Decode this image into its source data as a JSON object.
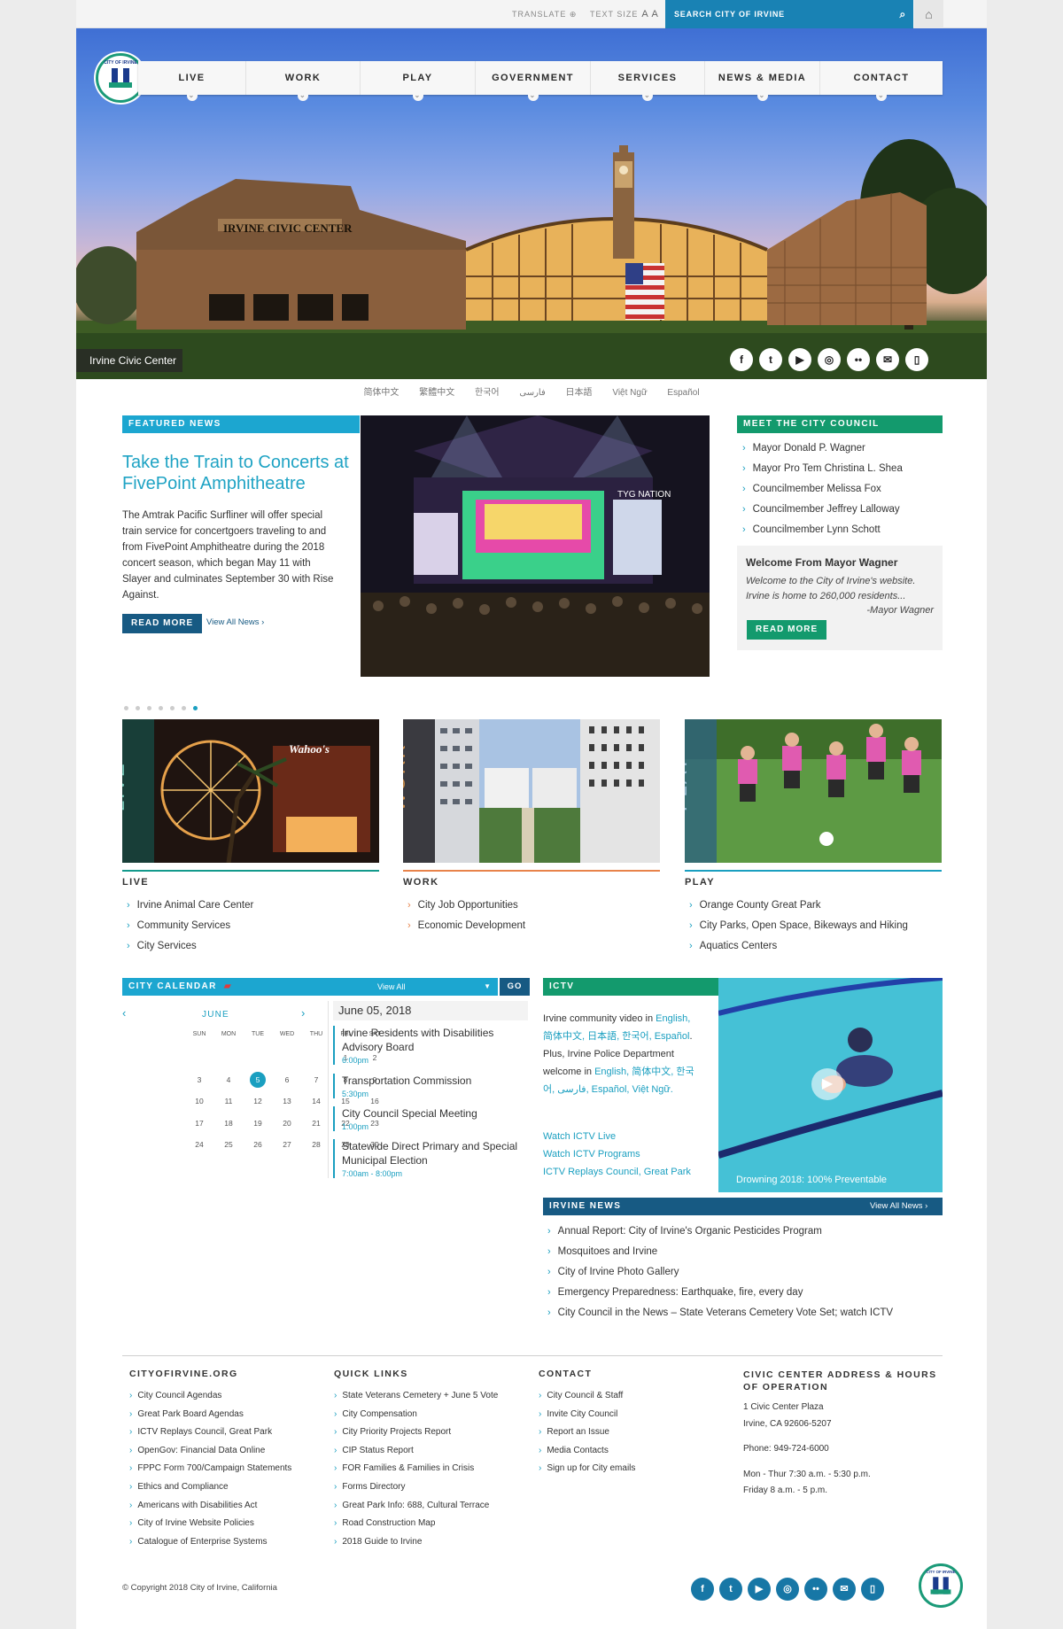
{
  "utility": {
    "translate": "TRANSLATE",
    "text_size": "TEXT SIZE",
    "text_size_glyph": "A A",
    "search_placeholder": "SEARCH CITY OF IRVINE"
  },
  "nav": {
    "items": [
      "LIVE",
      "WORK",
      "PLAY",
      "GOVERNMENT",
      "SERVICES",
      "NEWS & MEDIA",
      "CONTACT"
    ]
  },
  "hero": {
    "caption": "Irvine Civic Center",
    "building_sign": "IRVINE CIVIC CENTER"
  },
  "social_icons": [
    "facebook-icon",
    "twitter-icon",
    "youtube-icon",
    "instagram-icon",
    "flickr-icon",
    "email-icon",
    "mobile-icon"
  ],
  "languages": [
    "简体中文",
    "繁體中文",
    "한국어",
    "فارسی",
    "日本語",
    "Việt Ngữ",
    "Español"
  ],
  "featured": {
    "tag": "FEATURED NEWS",
    "headline": "Take the Train to Concerts at FivePoint Amphitheatre",
    "body": "The Amtrak Pacific Surfliner will offer special train service for concertgoers traveling to and from FivePoint Amphitheatre during the 2018 concert season, which began May 11 with Slayer and culminates September 30 with Rise Against.",
    "read_more": "READ MORE",
    "view_all": "View All News",
    "stage_banner": "TYG NATION"
  },
  "council": {
    "tag": "MEET THE CITY COUNCIL",
    "members": [
      "Mayor Donald P. Wagner",
      "Mayor Pro Tem Christina L. Shea",
      "Councilmember Melissa Fox",
      "Councilmember Jeffrey Lalloway",
      "Councilmember Lynn Schott"
    ],
    "welcome_title": "Welcome From Mayor Wagner",
    "welcome_text": "Welcome to the City of Irvine's website. Irvine is home to 260,000 residents...",
    "welcome_sign": "-Mayor Wagner",
    "read_more": "READ MORE"
  },
  "carousel": {
    "dot_count": 7,
    "active_index": 6
  },
  "panels": [
    {
      "title": "LIVE",
      "vlabel": "LIVE",
      "sign": "Wahoo's",
      "links": [
        "Irvine Animal Care Center",
        "Community Services",
        "City Services"
      ]
    },
    {
      "title": "WORK",
      "vlabel": "WORK",
      "links": [
        "City Job Opportunities",
        "Economic Development"
      ]
    },
    {
      "title": "PLAY",
      "vlabel": "PLAY",
      "links": [
        "Orange County Great Park",
        "City Parks, Open Space, Bikeways and Hiking",
        "Aquatics Centers"
      ]
    }
  ],
  "calendar": {
    "tag": "CITY CALENDAR",
    "view_all": "View All",
    "go": "GO",
    "month": "JUNE",
    "weekdays": [
      "SUN",
      "MON",
      "TUE",
      "WED",
      "THU",
      "FRI",
      "SAT"
    ],
    "weeks": [
      [
        "",
        "",
        "",
        "",
        "",
        "1",
        "2"
      ],
      [
        "3",
        "4",
        "5",
        "6",
        "7",
        "8",
        "9"
      ],
      [
        "10",
        "11",
        "12",
        "13",
        "14",
        "15",
        "16"
      ],
      [
        "17",
        "18",
        "19",
        "20",
        "21",
        "22",
        "23"
      ],
      [
        "24",
        "25",
        "26",
        "27",
        "28",
        "29",
        "30"
      ]
    ],
    "selected_day": "5",
    "date_heading": "June 05, 2018",
    "events": [
      {
        "title": "Irvine Residents with Disabilities Advisory Board",
        "time": "6:00pm"
      },
      {
        "title": "Transportation Commission",
        "time": "5:30pm"
      },
      {
        "title": "City Council Special Meeting",
        "time": "1:00pm"
      },
      {
        "title": "Statewide Direct Primary and Special Municipal Election",
        "time": "7:00am - 8:00pm"
      }
    ]
  },
  "ictv": {
    "tag": "ICTV",
    "intro": "Irvine community video in",
    "langs1": "English, 简体中文, 日本語, 한국어,",
    "langs2": "Español",
    "mid": ". Plus, Irvine Police Department welcome in",
    "langs3": "English,",
    "langs4": "简体中文, 한국어,",
    "langs5": "فارسی, Español, Việt Ngữ.",
    "links": [
      "Watch ICTV Live",
      "Watch ICTV Programs",
      "ICTV Replays Council, Great Park"
    ],
    "video_caption": "Drowning 2018: 100% Preventable"
  },
  "irvine_news": {
    "tag": "IRVINE NEWS",
    "view_all": "View All News",
    "items": [
      "Annual Report: City of Irvine's Organic Pesticides Program",
      "Mosquitoes and Irvine",
      "City of Irvine Photo Gallery",
      "Emergency Preparedness: Earthquake, fire, every day",
      "City Council in the News – State Veterans Cemetery Vote Set; watch ICTV"
    ]
  },
  "footer": {
    "col1": {
      "heading": "CITYOFIRVINE.ORG",
      "links": [
        "City Council Agendas",
        "Great Park Board Agendas",
        "ICTV Replays Council, Great Park",
        "OpenGov: Financial Data Online",
        "FPPC Form 700/Campaign Statements",
        "Ethics and Compliance",
        "Americans with Disabilities Act",
        "City of Irvine Website Policies",
        "Catalogue of Enterprise Systems"
      ]
    },
    "col2": {
      "heading": "QUICK LINKS",
      "links": [
        "State Veterans Cemetery + June 5 Vote",
        "City Compensation",
        "City Priority Projects Report",
        "CIP Status Report",
        "FOR Families & Families in Crisis",
        "Forms Directory",
        "Great Park Info: 688, Cultural Terrace",
        "Road Construction Map",
        "2018 Guide to Irvine"
      ]
    },
    "col3": {
      "heading": "CONTACT",
      "links": [
        "City Council & Staff",
        "Invite City Council",
        "Report an Issue",
        "Media Contacts",
        "Sign up for City emails"
      ]
    },
    "col4": {
      "heading_1": "CIVIC CENTER ADDRESS & HOURS",
      "heading_2": "OF OPERATION",
      "address_1": "1 Civic Center Plaza",
      "address_2": "Irvine, CA 92606-5207",
      "phone": "Phone: 949-724-6000",
      "hours_1": "Mon - Thur 7:30 a.m. - 5:30 p.m.",
      "hours_2": "Friday 8 a.m. - 5 p.m."
    },
    "copyright": "© Copyright 2018 City of Irvine, California"
  },
  "logo_text": "CITY OF IRVINE",
  "colors": {
    "teal": "#1a9fc0",
    "green": "#139a6d",
    "navy": "#175a83",
    "orange": "#e8834a"
  }
}
